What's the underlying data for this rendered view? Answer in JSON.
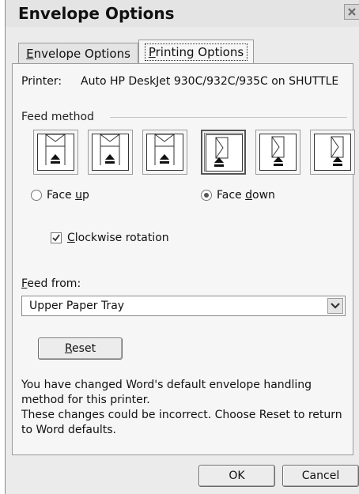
{
  "window": {
    "title": "Envelope Options"
  },
  "tabs": [
    {
      "label": "Envelope Options",
      "mnemonic": "E",
      "rest": "nvelope Options",
      "active": false
    },
    {
      "label": "Printing Options",
      "mnemonic": "P",
      "rest": "rinting Options",
      "active": true
    }
  ],
  "printer": {
    "label": "Printer:",
    "value": "Auto HP DeskJet 930C/932C/935C on SHUTTLE"
  },
  "feed_method": {
    "label": "Feed method",
    "options": [
      {
        "icon": "envelope-feed-face-up-left-icon",
        "selected": false
      },
      {
        "icon": "envelope-feed-face-up-center-icon",
        "selected": false
      },
      {
        "icon": "envelope-feed-face-up-right-icon",
        "selected": false
      },
      {
        "icon": "envelope-feed-face-down-left-icon",
        "selected": true
      },
      {
        "icon": "envelope-feed-face-down-center-icon",
        "selected": false
      },
      {
        "icon": "envelope-feed-face-down-right-icon",
        "selected": false
      }
    ],
    "face_up": {
      "pre": "Face ",
      "mnemonic": "u",
      "rest": "p",
      "checked": false
    },
    "face_down": {
      "pre": "Face ",
      "mnemonic": "d",
      "rest": "own",
      "checked": true
    }
  },
  "clockwise": {
    "mnemonic": "C",
    "rest": "lockwise rotation",
    "checked": true
  },
  "feed_from": {
    "mnemonic": "F",
    "rest": "eed from:",
    "value": "Upper Paper Tray"
  },
  "reset": {
    "mnemonic": "R",
    "rest": "eset"
  },
  "message": {
    "line1": "You have changed Word's default envelope handling method for this printer.",
    "line2": "These changes could be incorrect. Choose Reset to return to Word defaults."
  },
  "buttons": {
    "ok": "OK",
    "cancel": "Cancel"
  }
}
